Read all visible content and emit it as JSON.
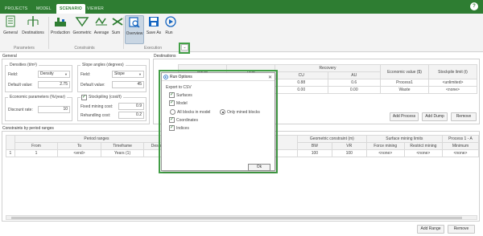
{
  "topbar": {
    "tabs": [
      "PROJECTS",
      "MODEL",
      "SCENARIO",
      "VIEWER"
    ],
    "active_tab": "SCENARIO",
    "help": "?"
  },
  "ribbon": {
    "buttons": {
      "general": "General",
      "destinations": "Destinations",
      "production": "Production",
      "geometric": "Geometric",
      "average": "Average",
      "sum": "Sum",
      "overview": "Overview",
      "save_as": "Save As",
      "run": "Run"
    },
    "groups": {
      "parameters": "Parameters",
      "constraints": "Constraints",
      "execution": "Execution"
    },
    "expand": "⌄"
  },
  "general": {
    "title": "General",
    "densities": {
      "title": "Densities (t/m³)",
      "field_label": "Field:",
      "field_value": "Density",
      "default_label": "Default value:",
      "default_value": "2.75"
    },
    "slope": {
      "title": "Slope angles (degrees)",
      "field_label": "Field:",
      "field_value": "Slope",
      "default_label": "Default value:",
      "default_value": "45"
    },
    "economic": {
      "title": "Economic parameters (%/year)",
      "discount_label": "Discount rate:",
      "discount_value": "10"
    },
    "stockpiling": {
      "title": "Stockpiling (cost/t)",
      "fixed_label": "Fixed mining cost:",
      "fixed_value": "0.9",
      "rehandling_label": "Rehandling cost:",
      "rehandling_value": "0.2"
    }
  },
  "destinations": {
    "title": "Destinations",
    "headers": {
      "name": "Name",
      "type": "Type",
      "recovery": "Recovery",
      "cu": "CU",
      "au": "AU",
      "economic": "Economic value ($)",
      "stockpile": "Stockpile limit (t)"
    },
    "rows": [
      {
        "cu": "0.88",
        "au": "0.6",
        "economic": "Process1",
        "stockpile": "<unlimited>"
      },
      {
        "cu": "0.00",
        "au": "0.00",
        "economic": "Waste",
        "stockpile": "<none>"
      }
    ],
    "buttons": {
      "add_process": "Add Process",
      "add_dump": "Add Dump",
      "remove": "Remove"
    }
  },
  "constraints": {
    "title": "Constraints by period ranges",
    "group_headers": {
      "period": "Period ranges",
      "geometric": "Geometric constraint (m)",
      "surface": "Surface mining limits",
      "process": "Process 1 - A"
    },
    "headers": {
      "from": "From",
      "to": "To",
      "timeframe": "Timeframe",
      "description": "Description",
      "bw": "BW",
      "vr": "VR",
      "force": "Force mining",
      "restrict": "Restrict mining",
      "minimum": "Minimum"
    },
    "rows": [
      {
        "idx": "1",
        "from": "1",
        "to": "<end>",
        "timeframe": "Years (1)",
        "description": "",
        "bw": "100",
        "vr": "100",
        "force": "<none>",
        "restrict": "<none>",
        "minimum": "<none>"
      }
    ],
    "buttons": {
      "add_range": "Add Range",
      "remove": "Remove"
    }
  },
  "dialog": {
    "title": "Run Options",
    "close": "✕",
    "export_label": "Export to CSV",
    "surfaces": "Surfaces",
    "model": "Model",
    "all_blocks": "All blocks in model",
    "only_mined": "Only mined blocks",
    "coordinates": "Coordinates",
    "indices": "Indices",
    "ok": "Ok"
  },
  "colors": {
    "brand": "#2e7d32",
    "highlight": "#43a047"
  }
}
